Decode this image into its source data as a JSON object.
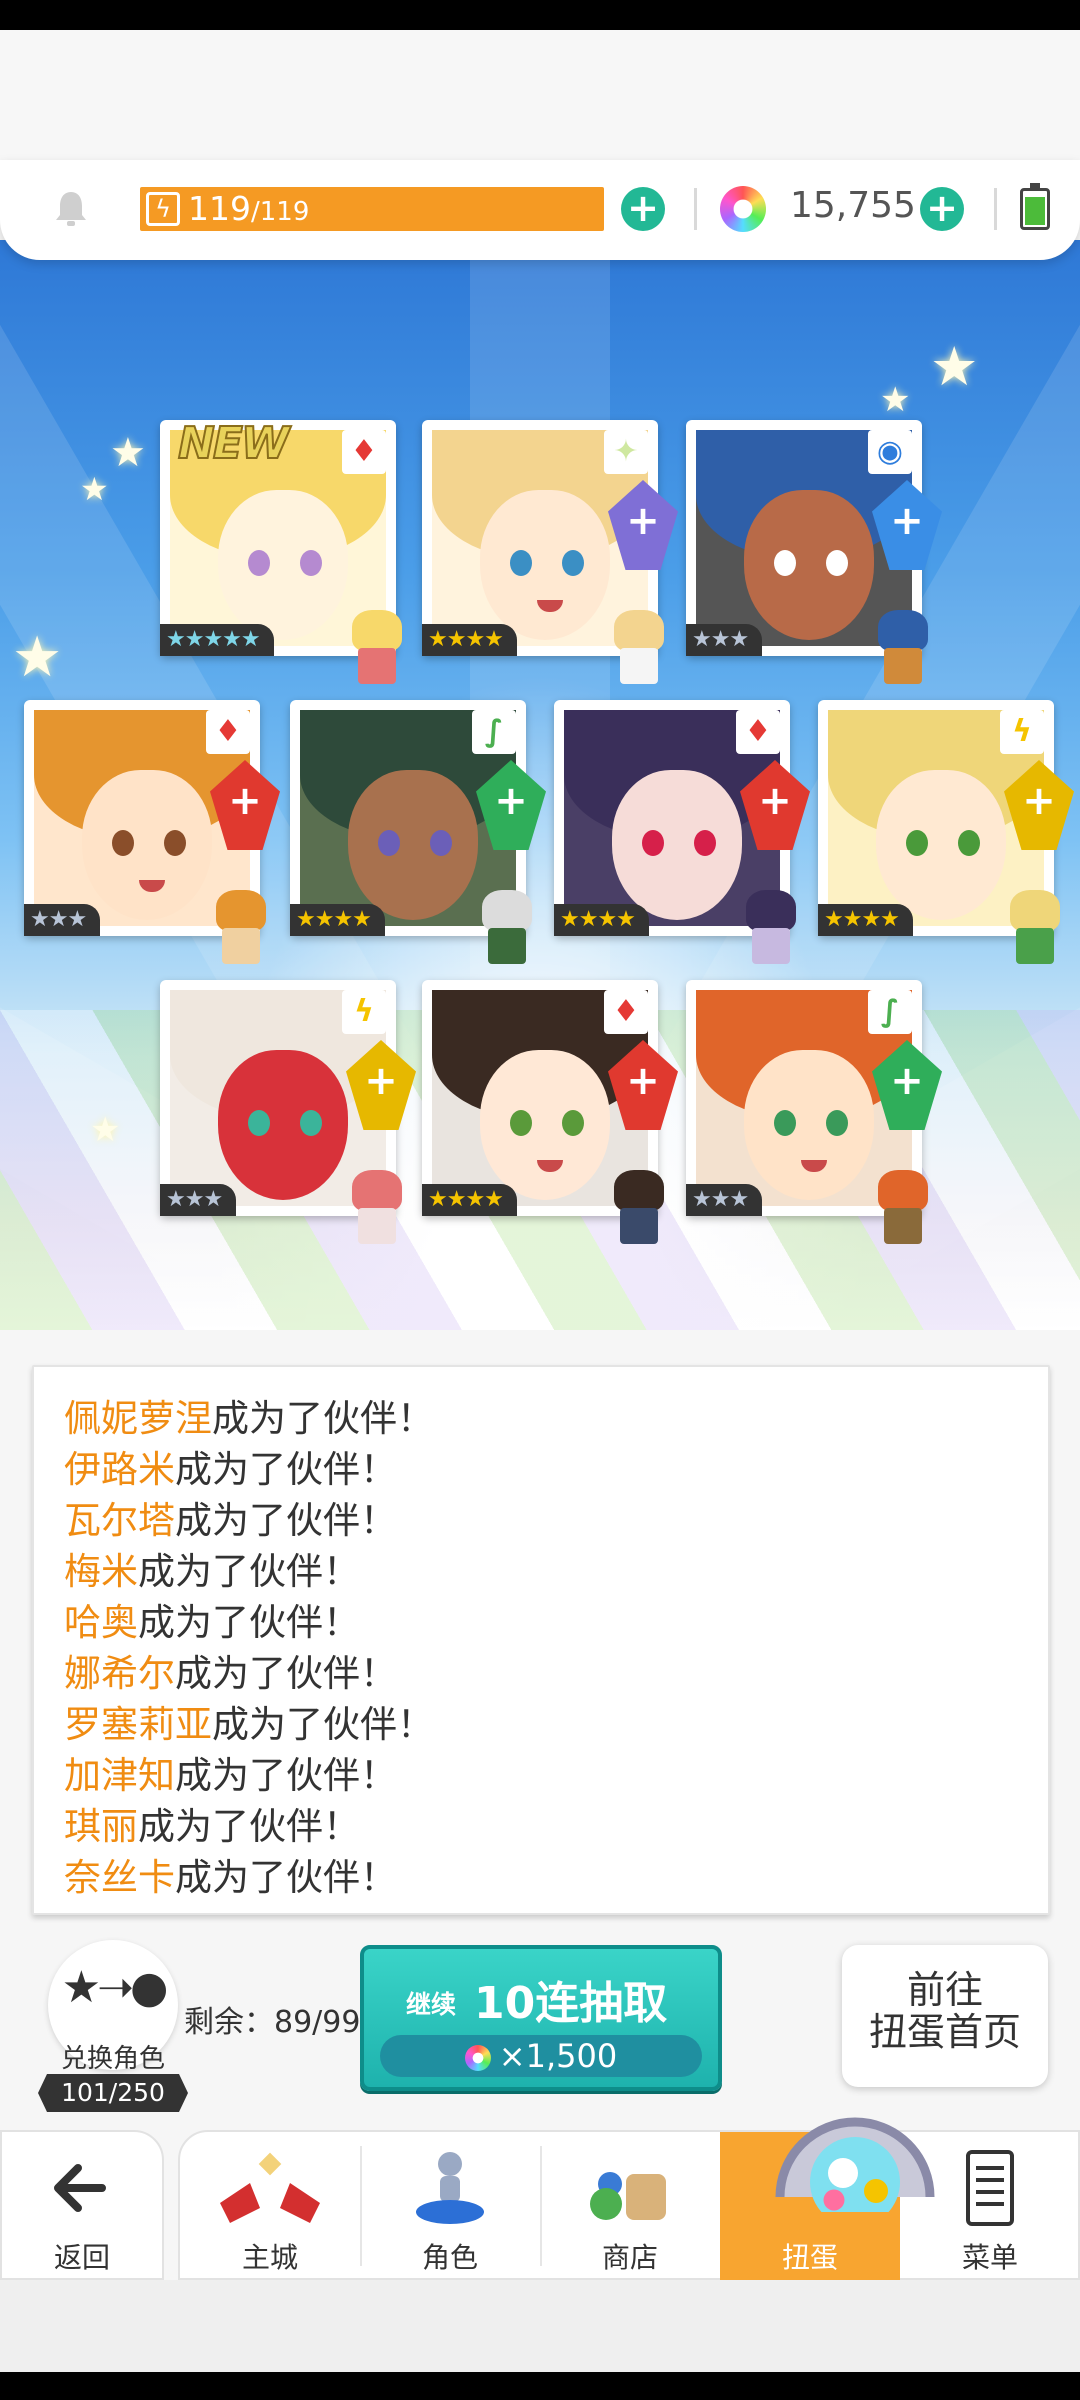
{
  "resources": {
    "stamina_current": "119",
    "stamina_max": "/119",
    "gems": "15,755",
    "plus_symbol": "+"
  },
  "cards": [
    {
      "stars": "★★★★★",
      "element": "fire-icon",
      "new_label": "NEW"
    },
    {
      "stars": "★★★★",
      "element": "light-icon"
    },
    {
      "stars": "★★★",
      "element": "water-icon"
    },
    {
      "stars": "★★★",
      "element": "fire-icon"
    },
    {
      "stars": "★★★★",
      "element": "wind-icon"
    },
    {
      "stars": "★★★★",
      "element": "fire-icon"
    },
    {
      "stars": "★★★★",
      "element": "thunder-icon"
    },
    {
      "stars": "★★★",
      "element": "thunder-icon"
    },
    {
      "stars": "★★★★",
      "element": "fire-icon"
    },
    {
      "stars": "★★★",
      "element": "wind-icon"
    }
  ],
  "messages": [
    {
      "name": "佩妮萝涅",
      "suffix": "成为了伙伴！"
    },
    {
      "name": "伊路米",
      "suffix": "成为了伙伴！"
    },
    {
      "name": "瓦尔塔",
      "suffix": "成为了伙伴！"
    },
    {
      "name": "梅米",
      "suffix": "成为了伙伴！"
    },
    {
      "name": "哈奥",
      "suffix": "成为了伙伴！"
    },
    {
      "name": "娜希尔",
      "suffix": "成为了伙伴！"
    },
    {
      "name": "罗塞莉亚",
      "suffix": "成为了伙伴！"
    },
    {
      "name": "加津知",
      "suffix": "成为了伙伴！"
    },
    {
      "name": "琪丽",
      "suffix": "成为了伙伴！"
    },
    {
      "name": "奈丝卡",
      "suffix": "成为了伙伴！"
    }
  ],
  "exchange": {
    "label": "兑换角色",
    "count": "101/250",
    "remaining": "剩余：89/99"
  },
  "draw_button": {
    "continue": "继续",
    "label": "10连抽取",
    "cost": "×1,500"
  },
  "home_button": {
    "line1": "前往",
    "line2": "扭蛋首页"
  },
  "nav": {
    "back": "返回",
    "tabs": [
      "主城",
      "角色",
      "商店",
      "扭蛋",
      "菜单"
    ],
    "active_tab": "扭蛋"
  },
  "colors": {
    "accent_orange": "#f59a23",
    "name_orange": "#f08c12",
    "teal_button": "#1eb2ad",
    "plus_green": "#22b895"
  }
}
